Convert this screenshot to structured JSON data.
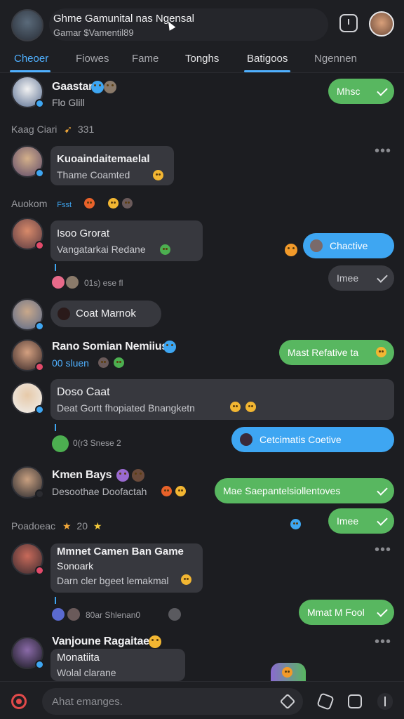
{
  "header": {
    "title": "Ghme Gamunital nas Ngensal",
    "subtitle": "Gamar $Vamentil89"
  },
  "tabs": [
    {
      "label": "Cheoer"
    },
    {
      "label": "Fiowes"
    },
    {
      "label": "Fame"
    },
    {
      "label": "Tonghs"
    },
    {
      "label": "Batigoos"
    },
    {
      "label": "Ngennen"
    }
  ],
  "conversations": [
    {
      "name": "Gaastar",
      "sub": "Flo Glill",
      "reply": "Mhsc"
    },
    {
      "name": "Kuoaindaitemaelal",
      "sub": "Thame Coamted"
    },
    {
      "name": "Isoo Grorat",
      "sub": "Vangatarkai Redane",
      "reply": "Chactive"
    },
    {
      "name": "Coat Marnok",
      "reply": "Imee"
    },
    {
      "name": "Rano Somian Nemiius",
      "sub": "00 sluen",
      "reply": "Mast Refative ta"
    },
    {
      "name": "Doso Caat",
      "sub": "Deat Gortt fhopiated Bnangketn",
      "reply": "Cetcimatis Coetive"
    },
    {
      "name": "Kmen Bays",
      "sub": "Desoothae Doofactah",
      "reply": "Mae Saepantelsiollentoves"
    },
    {
      "name": "Mmnet Camen Ban Game",
      "sub": "Sonoark",
      "sub2": "Darn cler bgeet lemakmal",
      "reply": "Imee"
    },
    {
      "name": "Vanjoune Ragaitae",
      "sub": "Monatiita",
      "sub2": "Wolal clarane",
      "reply": "Mmat M Fool"
    }
  ],
  "sections": {
    "s1": "Kaag Ciari",
    "s1_count": "331",
    "s2": "Auokom",
    "s2_tag": "Fsst",
    "s3": "Poadoeac",
    "s3_count": "20"
  },
  "reactions": {
    "r1": "01s) ese fl",
    "r2": "0(r3 Snese 2",
    "r3": "80ar Shlenan0"
  },
  "composer": {
    "placeholder": "Ahat emanges."
  },
  "colors": {
    "accent": "#4fb0ff",
    "green": "#58b760",
    "blue": "#3ea6f2",
    "background": "#1c1d21"
  }
}
